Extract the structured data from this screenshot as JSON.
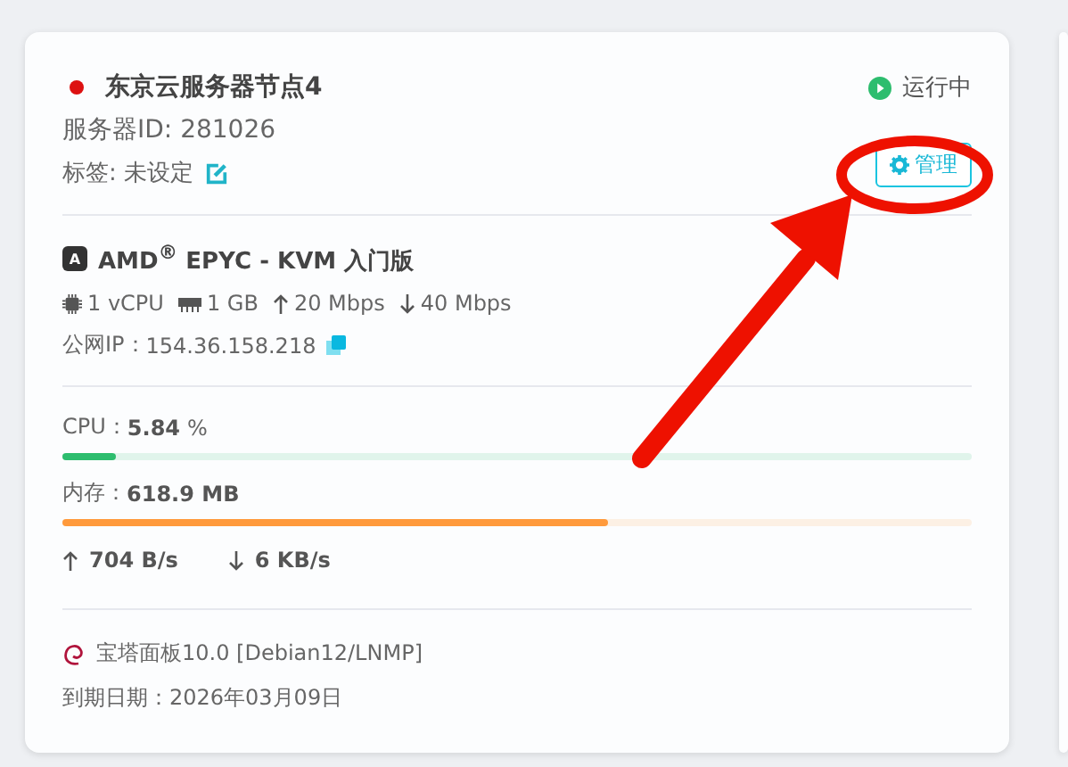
{
  "server": {
    "name": "东京云服务器节点4",
    "color": "#dd1111",
    "status": "运行中",
    "running": true,
    "id_text": "服务器ID: 281026",
    "tag_text": "标签: 未设定",
    "manage_button": "管理"
  },
  "plan": {
    "badge": "A",
    "title": "AMD$^{®}$ EPYC - KVM 入门版",
    "specs": [
      {
        "kind": "cpu",
        "text": "1 vCPU"
      },
      {
        "kind": "ram",
        "text": "1 GB"
      },
      {
        "kind": "up",
        "text": "20 Mbps"
      },
      {
        "kind": "down",
        "text": "40 Mbps"
      }
    ],
    "ip_label": "公网IP：",
    "ip": "154.36.158.218"
  },
  "usage": [
    {
      "label": "CPU：",
      "value": "5.84",
      "unit": "%",
      "level": 0.058,
      "color": "#2dbd6e"
    },
    {
      "label": "内存：",
      "value": "618.9 MB",
      "level": 0.6,
      "color": "#ff9a3c"
    }
  ],
  "traffic": {
    "up": "704 B/s",
    "down": "6 KB/s"
  },
  "footer": {
    "panel": "宝塔面板10.0 [Debian12/LNMP]",
    "expiry": "到期日期：2026年03月09日"
  }
}
